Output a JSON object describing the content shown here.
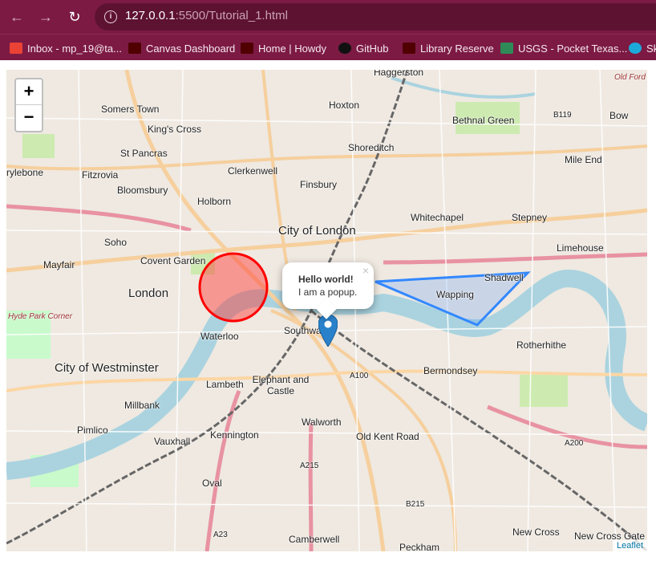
{
  "browser": {
    "url_host": "127.0.0.1",
    "url_rest": ":5500/Tutorial_1.html",
    "bookmarks": [
      {
        "label": "Inbox - mp_19@ta...",
        "icon": "gmail-icon",
        "color": "#ea4335"
      },
      {
        "label": "Canvas Dashboard",
        "icon": "atm-logo-icon",
        "color": "#500000"
      },
      {
        "label": "Home | Howdy",
        "icon": "atm-logo-icon",
        "color": "#500000"
      },
      {
        "label": "GitHub",
        "icon": "github-icon",
        "color": "#111111"
      },
      {
        "label": "Library Reserve",
        "icon": "atm-logo-icon",
        "color": "#500000"
      },
      {
        "label": "USGS - Pocket Texas...",
        "icon": "usgs-icon",
        "color": "#2e8b57"
      },
      {
        "label": "Sk",
        "icon": "sketchfab-icon",
        "color": "#1caad9"
      }
    ]
  },
  "map": {
    "zoom_in": "+",
    "zoom_out": "−",
    "popup": {
      "title": "Hello world!",
      "text": "I am a popup.",
      "close": "×"
    },
    "attribution": "Leaflet",
    "labels": [
      "Haggerston",
      "Somers Town",
      "Hoxton",
      "King's Cross",
      "Bethnal Green",
      "Bow",
      "St Pancras",
      "Shoreditch",
      "Mile End",
      "rylebone",
      "Fitzrovia",
      "Clerkenwell",
      "Finsbury",
      "Bloomsbury",
      "Holborn",
      "Whitechapel",
      "Stepney",
      "Soho",
      "City of London",
      "Limehouse",
      "Mayfair",
      "Covent Garden",
      "Shadwell",
      "London",
      "Wapping",
      "Southwark",
      "Waterloo",
      "Rotherhithe",
      "City of Westminster",
      "Bermondsey",
      "Elephant and Castle",
      "Lambeth",
      "Millbank",
      "Walworth",
      "Pimlico",
      "Kennington",
      "Old Kent Road",
      "Vauxhall",
      "Oval",
      "Camberwell",
      "Peckham",
      "New Cross",
      "New Cross Gate",
      "A100",
      "A215",
      "B215",
      "A23",
      "A200",
      "B119",
      "Old Ford",
      "Hyde Park Corner"
    ]
  },
  "colors": {
    "circle": "#ff0000",
    "polygon": "#3388ff",
    "marker": "#2a81cb",
    "river": "#aad3df"
  }
}
